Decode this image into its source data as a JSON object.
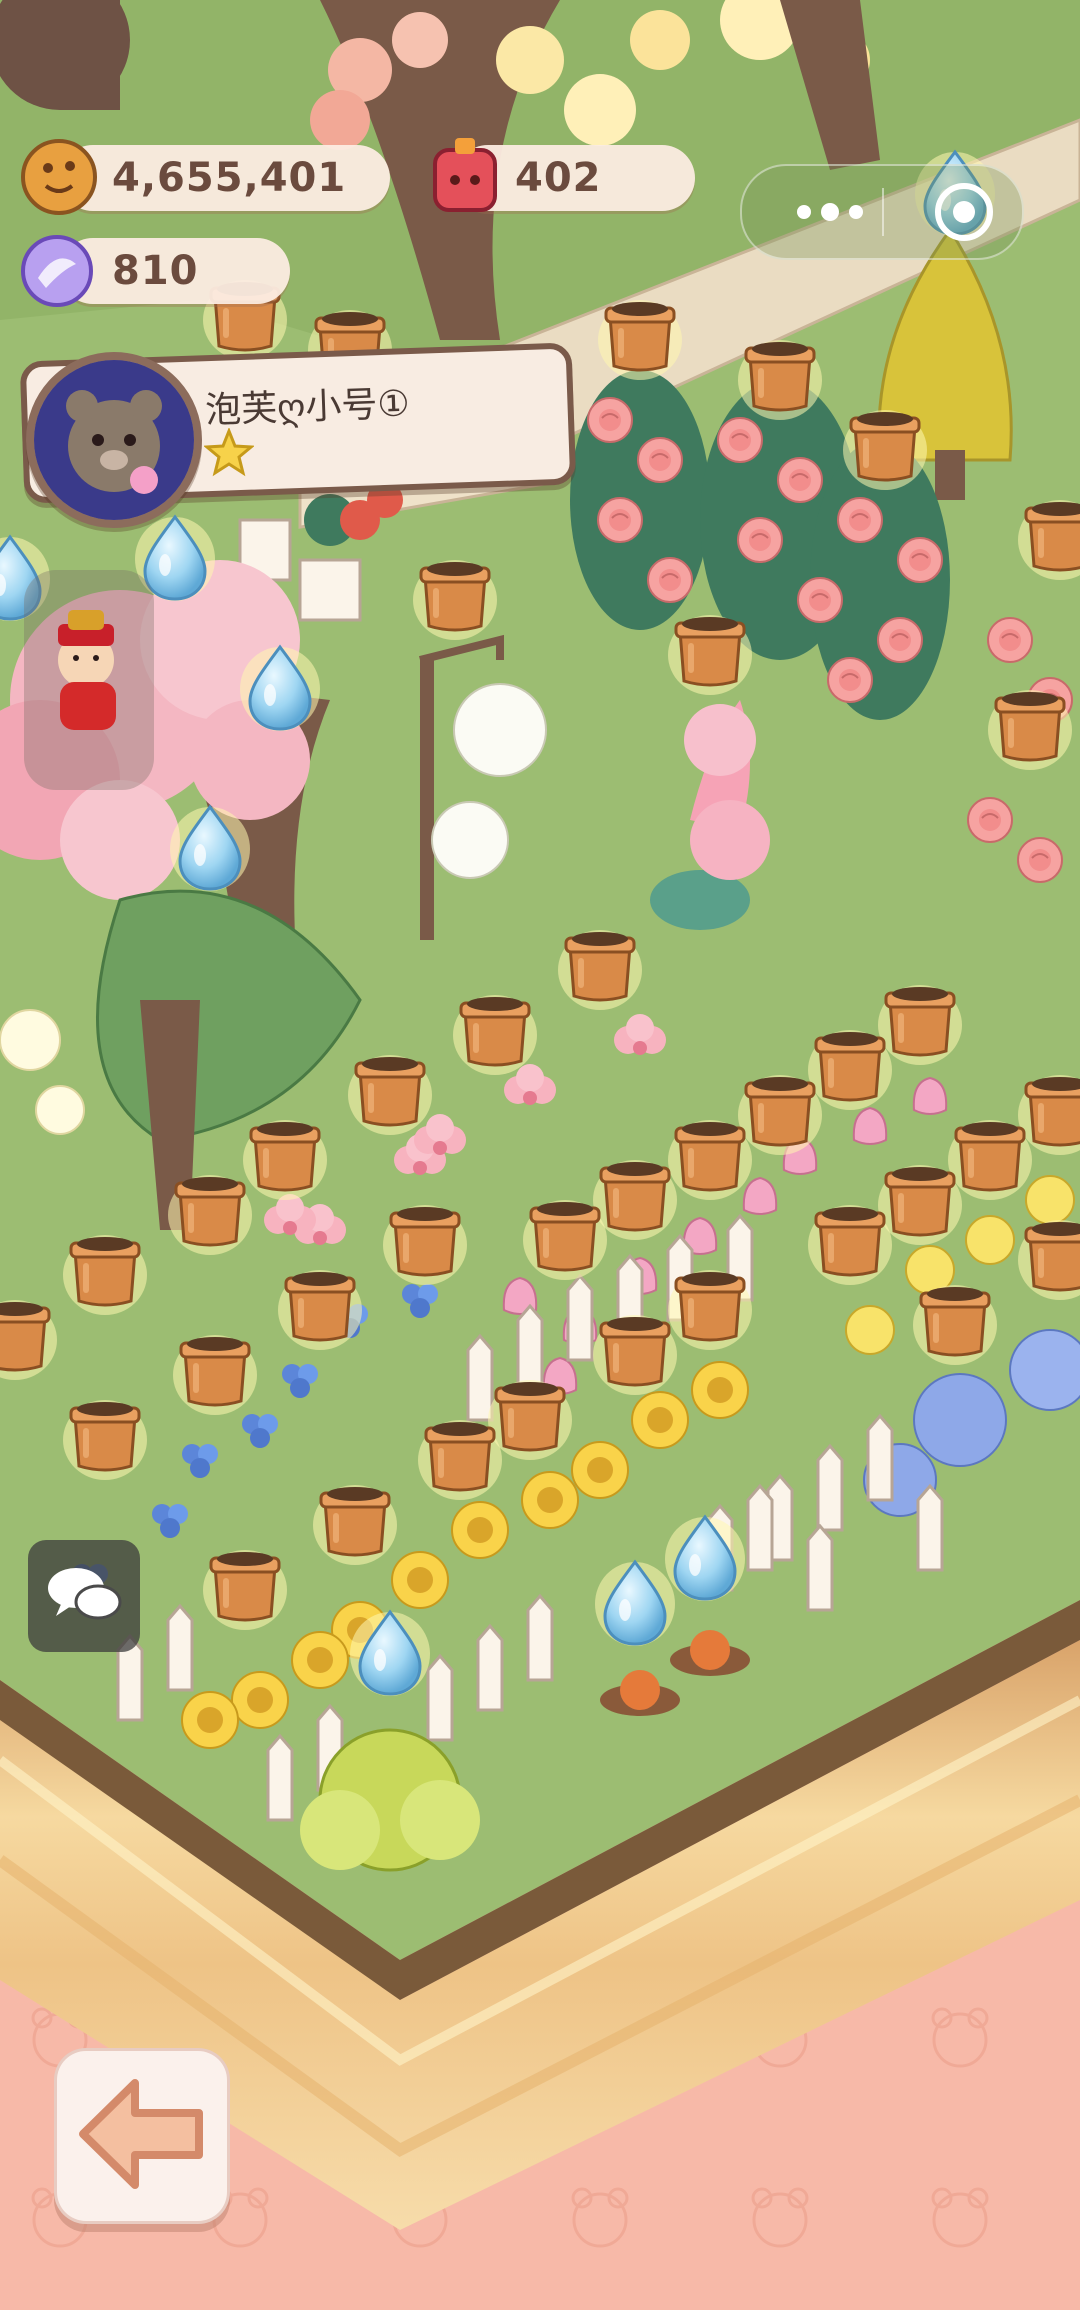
{
  "hud": {
    "coins": "4,655,401",
    "gems": "402",
    "crystals": "810"
  },
  "profile": {
    "player_name": "泡芙ღ小号①",
    "star_level": 1
  },
  "icons": {
    "coin": "cookie-coin-icon",
    "gem": "red-gem-icon",
    "crystal": "purple-crystal-icon",
    "more": "more-dots-icon",
    "close_target": "target-icon",
    "chat": "chat-bubbles-icon",
    "back": "arrow-left-icon",
    "water": "water-drop-icon",
    "harvest": "flower-pot-icon",
    "god_of_wealth": "god-of-wealth-icon"
  },
  "colors": {
    "grass": "#9cbd72",
    "soil_cake": "#f2cf95",
    "background": "#f7b9a8",
    "pot": "#d98a48",
    "water_drop": "#9fd6f2"
  }
}
